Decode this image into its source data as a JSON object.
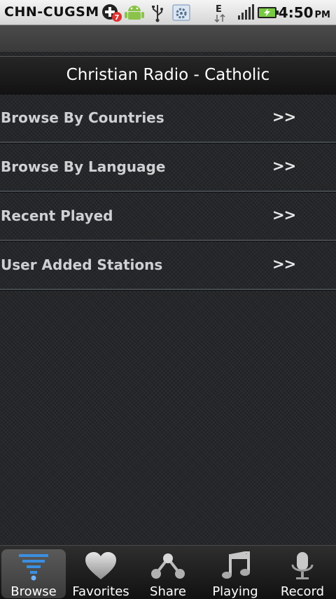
{
  "status_bar": {
    "carrier": "CHN-CUGSM",
    "notification_badge": "7",
    "network_type": "E",
    "time": "4:50",
    "ampm": "PM"
  },
  "app_title": "Christian Radio - Catholic",
  "menu": {
    "arrow": ">>",
    "items": [
      {
        "label": "Browse By Countries"
      },
      {
        "label": "Browse By Language"
      },
      {
        "label": "Recent Played"
      },
      {
        "label": "User Added Stations"
      }
    ]
  },
  "tabs": [
    {
      "label": "Browse",
      "icon": "browse-icon",
      "active": true
    },
    {
      "label": "Favorites",
      "icon": "heart-icon",
      "active": false
    },
    {
      "label": "Share",
      "icon": "share-icon",
      "active": false
    },
    {
      "label": "Playing",
      "icon": "music-note-icon",
      "active": false
    },
    {
      "label": "Record",
      "icon": "microphone-icon",
      "active": false
    }
  ],
  "colors": {
    "background": "#222427",
    "accent_blue": "#2f7fd6",
    "text": "#cfd0d2"
  }
}
